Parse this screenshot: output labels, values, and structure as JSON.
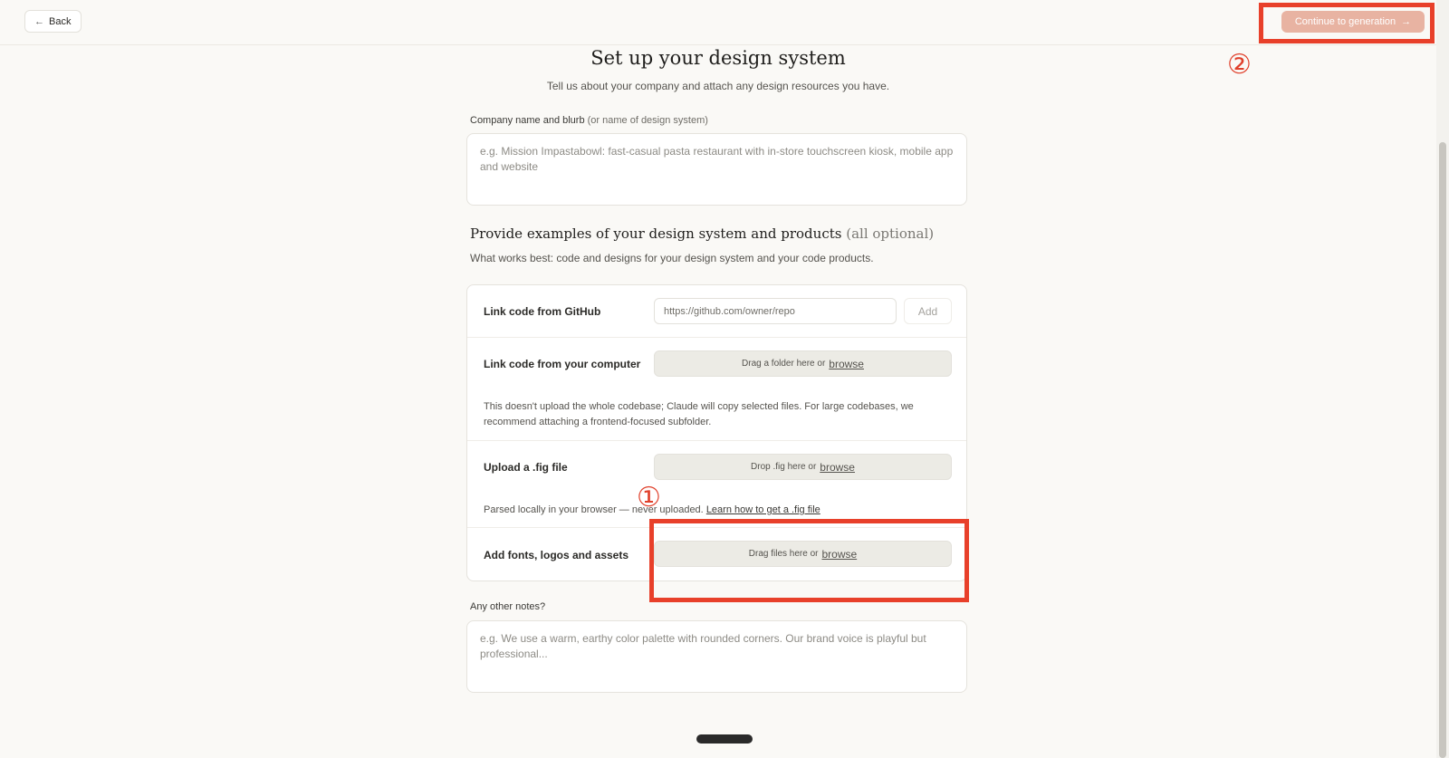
{
  "topbar": {
    "back_label": "Back",
    "back_icon": "arrow-left-icon",
    "continue_label": "Continue to generation",
    "continue_icon": "arrow-right-icon"
  },
  "annotations": {
    "one": "①",
    "two": "②",
    "color": "#e8402a"
  },
  "header": {
    "title": "Set up your design system",
    "subtitle": "Tell us about your company and attach any design resources you have."
  },
  "company": {
    "label": "Company name and blurb",
    "label_muted": "(or name of design system)",
    "placeholder": "e.g. Mission Impastabowl: fast-casual pasta restaurant with in-store touchscreen kiosk, mobile app and website"
  },
  "examples": {
    "heading": "Provide examples of your design system and products",
    "heading_optional": "(all optional)",
    "description": "What works best: code and designs for your design system and your code products.",
    "github": {
      "label": "Link code from GitHub",
      "placeholder": "https://github.com/owner/repo",
      "add_label": "Add"
    },
    "computer": {
      "label": "Link code from your computer",
      "drop_text": "Drag a folder here or",
      "browse_label": "browse",
      "note": "This doesn't upload the whole codebase; Claude will copy selected files. For large codebases, we recommend attaching a frontend-focused subfolder."
    },
    "fig": {
      "label": "Upload a .fig file",
      "drop_text": "Drop .fig here or",
      "browse_label": "browse",
      "note": "Parsed locally in your browser — never uploaded.",
      "note_link": "Learn how to get a .fig file"
    },
    "assets": {
      "label": "Add fonts, logos and assets",
      "drop_text": "Drag files here or",
      "browse_label": "browse"
    }
  },
  "notes": {
    "label": "Any other notes?",
    "placeholder": "e.g. We use a warm, earthy color palette with rounded corners. Our brand voice is playful but professional..."
  },
  "colors": {
    "accent": "#e8b3a2",
    "background": "#faf9f6"
  }
}
